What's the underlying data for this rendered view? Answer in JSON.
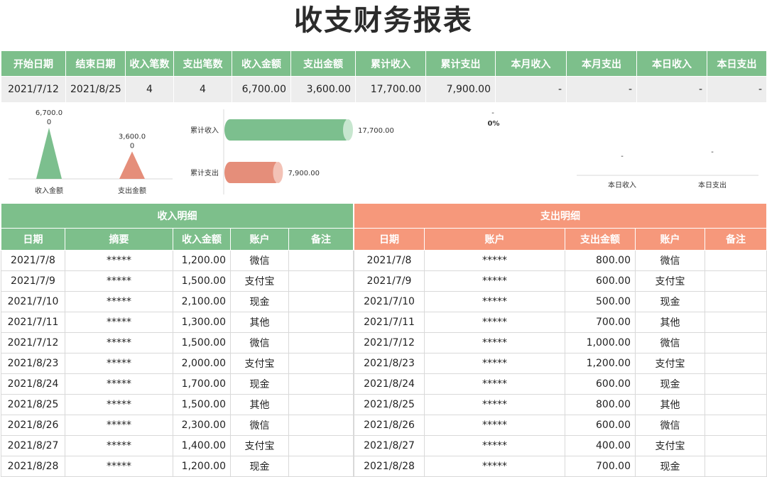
{
  "title": "收支财务报表",
  "summary": {
    "headers": [
      "开始日期",
      "结束日期",
      "收入笔数",
      "支出笔数",
      "收入金额",
      "支出金额",
      "累计收入",
      "累计支出",
      "本月收入",
      "本月支出",
      "本日收入",
      "本日支出"
    ],
    "values": [
      "2021/7/12",
      "2021/8/25",
      "4",
      "4",
      "6,700.00",
      "3,600.00",
      "17,700.00",
      "7,900.00",
      "-",
      "-",
      "-",
      "-"
    ]
  },
  "colors": {
    "green": "#7dbf8b",
    "orange": "#f6987b",
    "bar_green": "#7cbf8e",
    "bar_red": "#e58e7a"
  },
  "chart_data": [
    {
      "type": "bar",
      "categories": [
        "收入金额",
        "支出金额"
      ],
      "values": [
        6700,
        3600
      ],
      "value_labels": [
        "6,700.0\n0",
        "3,600.0\n0"
      ]
    },
    {
      "type": "bar",
      "orientation": "horizontal",
      "categories": [
        "累计收入",
        "累计支出"
      ],
      "values": [
        17700,
        7900
      ],
      "value_labels": [
        "17,700.00",
        "7,900.00"
      ]
    },
    {
      "type": "pie",
      "labels": [
        "-",
        "0%"
      ]
    },
    {
      "type": "bar",
      "categories": [
        "本日收入",
        "本日支出"
      ],
      "value_labels": [
        "-",
        "-"
      ]
    }
  ],
  "income": {
    "group_title": "收入明细",
    "headers": [
      "日期",
      "摘要",
      "收入金额",
      "账户",
      "备注"
    ],
    "rows": [
      [
        "2021/7/8",
        "*****",
        "1,200.00",
        "微信",
        ""
      ],
      [
        "2021/7/9",
        "*****",
        "1,500.00",
        "支付宝",
        ""
      ],
      [
        "2021/7/10",
        "*****",
        "2,100.00",
        "现金",
        ""
      ],
      [
        "2021/7/11",
        "*****",
        "1,300.00",
        "其他",
        ""
      ],
      [
        "2021/7/12",
        "*****",
        "1,500.00",
        "微信",
        ""
      ],
      [
        "2021/8/23",
        "*****",
        "2,000.00",
        "支付宝",
        ""
      ],
      [
        "2021/8/24",
        "*****",
        "1,700.00",
        "现金",
        ""
      ],
      [
        "2021/8/25",
        "*****",
        "1,500.00",
        "其他",
        ""
      ],
      [
        "2021/8/26",
        "*****",
        "2,300.00",
        "微信",
        ""
      ],
      [
        "2021/8/27",
        "*****",
        "1,400.00",
        "支付宝",
        ""
      ],
      [
        "2021/8/28",
        "*****",
        "1,200.00",
        "现金",
        ""
      ]
    ]
  },
  "expense": {
    "group_title": "支出明细",
    "headers": [
      "日期",
      "账户",
      "支出金额",
      "账户",
      "备注"
    ],
    "rows": [
      [
        "2021/7/8",
        "*****",
        "800.00",
        "微信",
        ""
      ],
      [
        "2021/7/9",
        "*****",
        "600.00",
        "支付宝",
        ""
      ],
      [
        "2021/7/10",
        "*****",
        "500.00",
        "现金",
        ""
      ],
      [
        "2021/7/11",
        "*****",
        "700.00",
        "其他",
        ""
      ],
      [
        "2021/7/12",
        "*****",
        "1,000.00",
        "微信",
        ""
      ],
      [
        "2021/8/23",
        "*****",
        "1,200.00",
        "支付宝",
        ""
      ],
      [
        "2021/8/24",
        "*****",
        "600.00",
        "现金",
        ""
      ],
      [
        "2021/8/25",
        "*****",
        "800.00",
        "其他",
        ""
      ],
      [
        "2021/8/26",
        "*****",
        "600.00",
        "微信",
        ""
      ],
      [
        "2021/8/27",
        "*****",
        "400.00",
        "支付宝",
        ""
      ],
      [
        "2021/8/28",
        "*****",
        "700.00",
        "现金",
        ""
      ]
    ]
  }
}
